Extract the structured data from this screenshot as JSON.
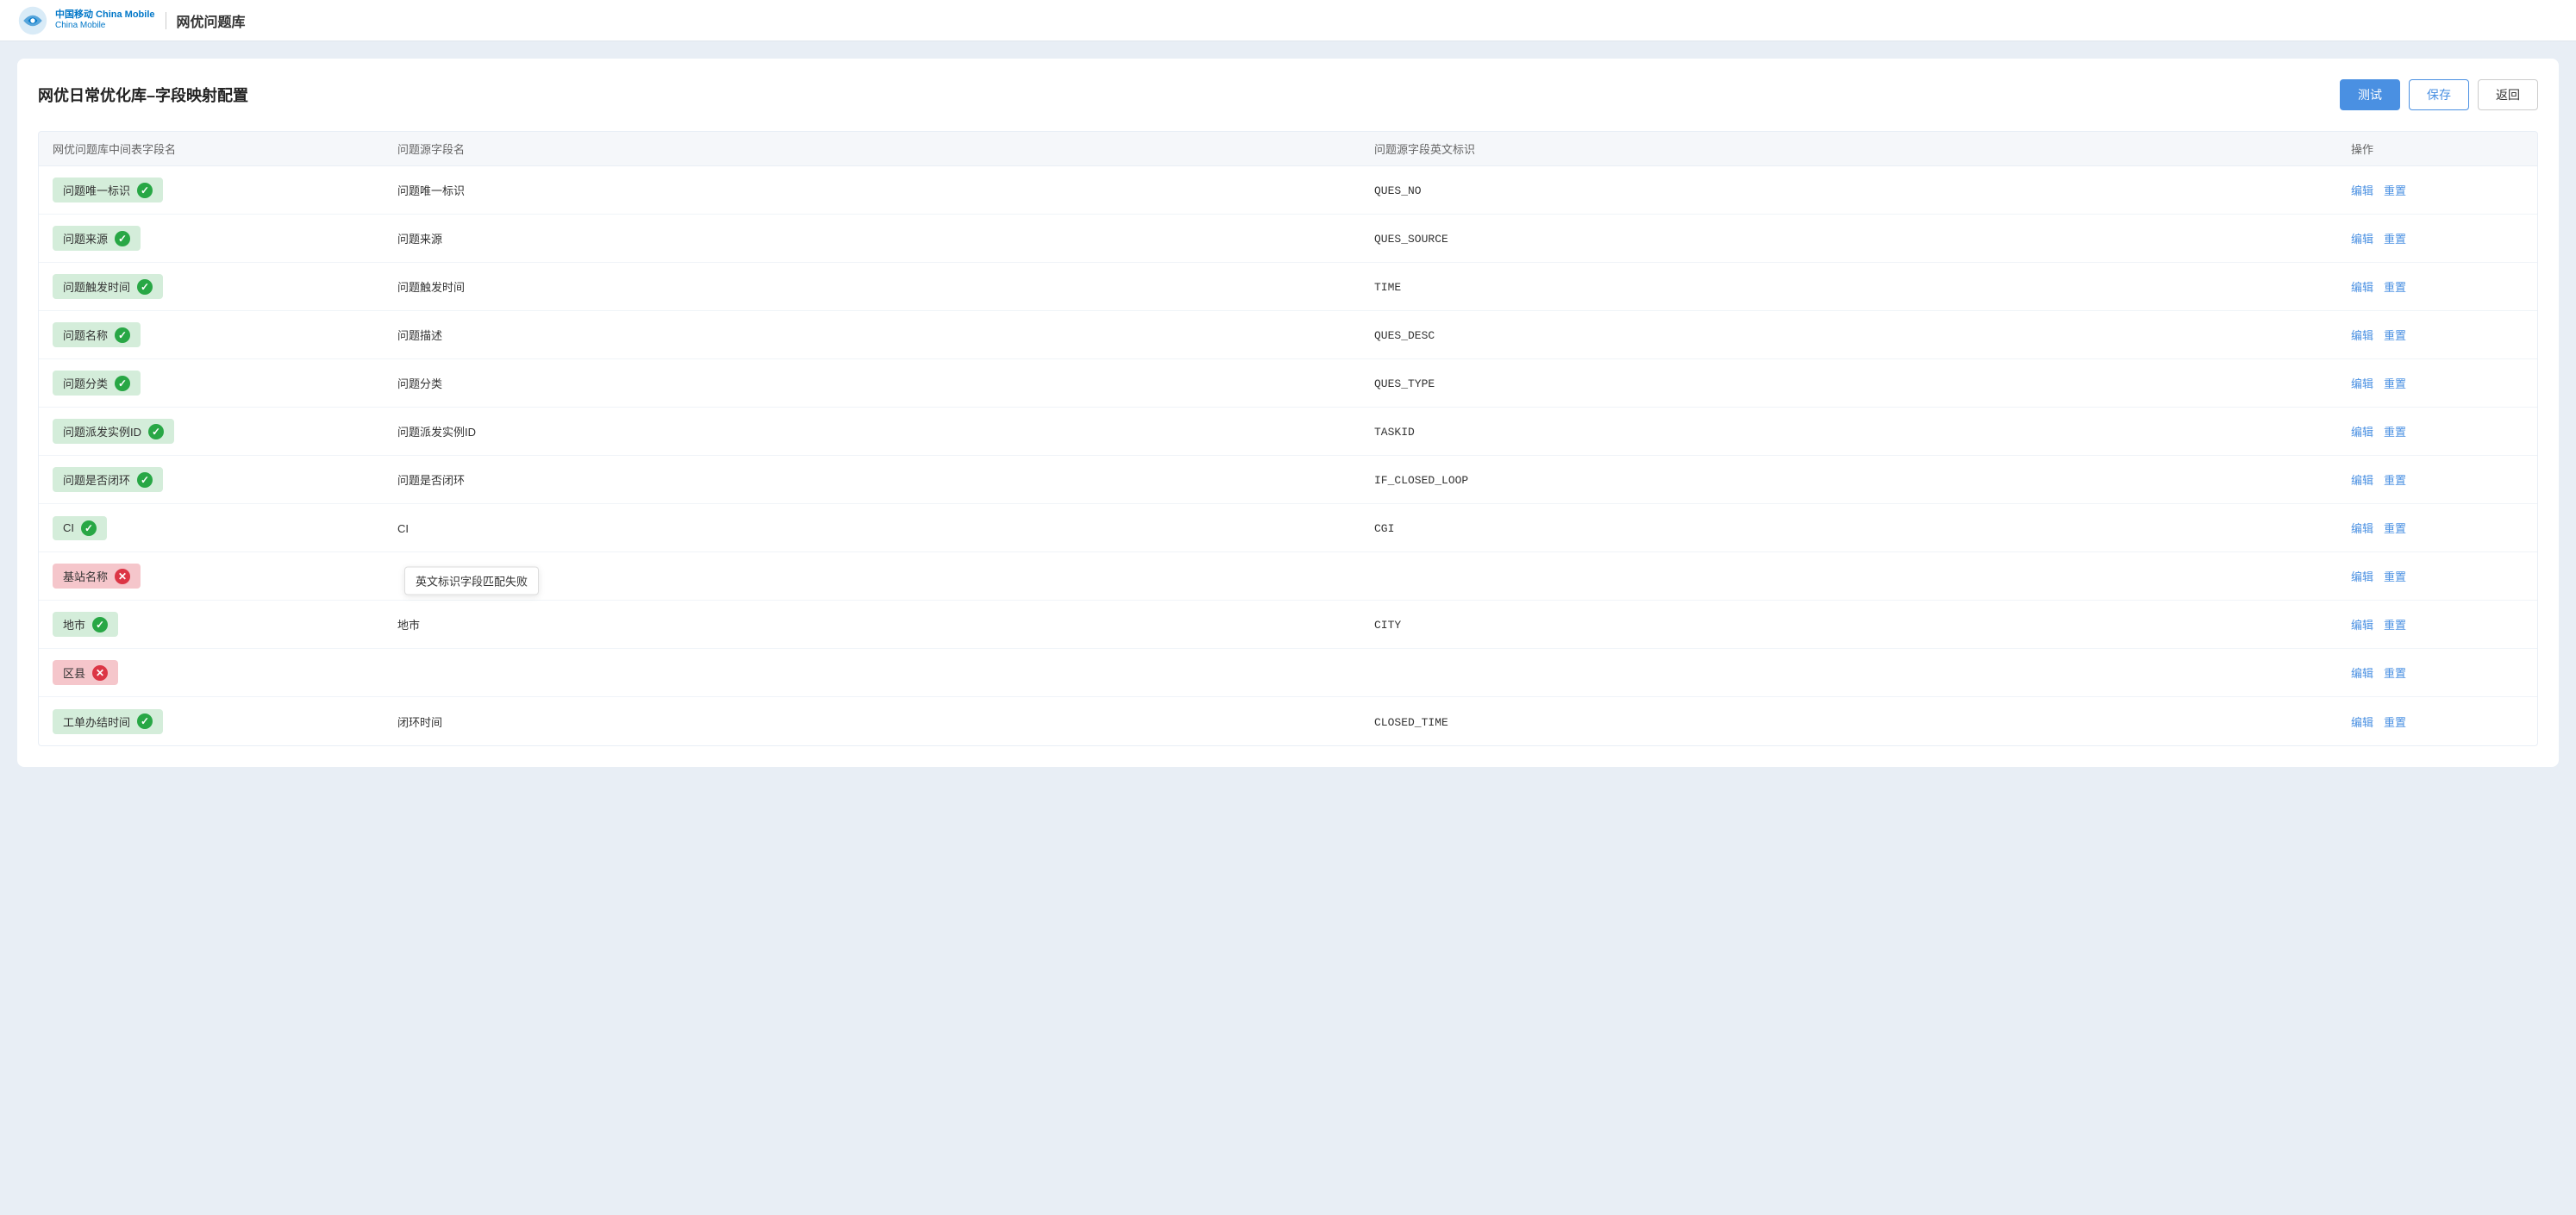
{
  "header": {
    "logo_text": "中国移动\nChina Mobile",
    "site_title": "网优问题库",
    "divider": true
  },
  "page": {
    "title": "网优日常优化库–字段映射配置",
    "actions": {
      "test_label": "测试",
      "save_label": "保存",
      "back_label": "返回"
    }
  },
  "table": {
    "columns": [
      "网优问题库中间表字段名",
      "问题源字段名",
      "问题源字段英文标识",
      "操作"
    ],
    "rows": [
      {
        "id": 1,
        "field_name": "问题唯一标识",
        "status": "green",
        "source_field": "问题唯一标识",
        "source_english": "QUES_NO",
        "tooltip": null
      },
      {
        "id": 2,
        "field_name": "问题来源",
        "status": "green",
        "source_field": "问题来源",
        "source_english": "QUES_SOURCE",
        "tooltip": null
      },
      {
        "id": 3,
        "field_name": "问题触发时间",
        "status": "green",
        "source_field": "问题触发时间",
        "source_english": "TIME",
        "tooltip": null
      },
      {
        "id": 4,
        "field_name": "问题名称",
        "status": "green",
        "source_field": "问题描述",
        "source_english": "QUES_DESC",
        "tooltip": null
      },
      {
        "id": 5,
        "field_name": "问题分类",
        "status": "green",
        "source_field": "问题分类",
        "source_english": "QUES_TYPE",
        "tooltip": null
      },
      {
        "id": 6,
        "field_name": "问题派发实例ID",
        "status": "green",
        "source_field": "问题派发实例ID",
        "source_english": "TASKID",
        "tooltip": null
      },
      {
        "id": 7,
        "field_name": "问题是否闭环",
        "status": "green",
        "source_field": "问题是否闭环",
        "source_english": "IF_CLOSED_LOOP",
        "tooltip": null
      },
      {
        "id": 8,
        "field_name": "CI",
        "status": "green",
        "source_field": "CI",
        "source_english": "CGI",
        "tooltip": null
      },
      {
        "id": 9,
        "field_name": "基站名称",
        "status": "red",
        "source_field": "",
        "source_english": "",
        "tooltip": "英文标识字段匹配失败"
      },
      {
        "id": 10,
        "field_name": "地市",
        "status": "green",
        "source_field": "地市",
        "source_english": "CITY",
        "tooltip": null
      },
      {
        "id": 11,
        "field_name": "区县",
        "status": "red",
        "source_field": "",
        "source_english": "",
        "tooltip": null
      },
      {
        "id": 12,
        "field_name": "工单办结时间",
        "status": "green",
        "source_field": "闭环时间",
        "source_english": "CLOSED_TIME",
        "tooltip": null
      }
    ],
    "action_edit": "编辑",
    "action_reset": "重置"
  }
}
